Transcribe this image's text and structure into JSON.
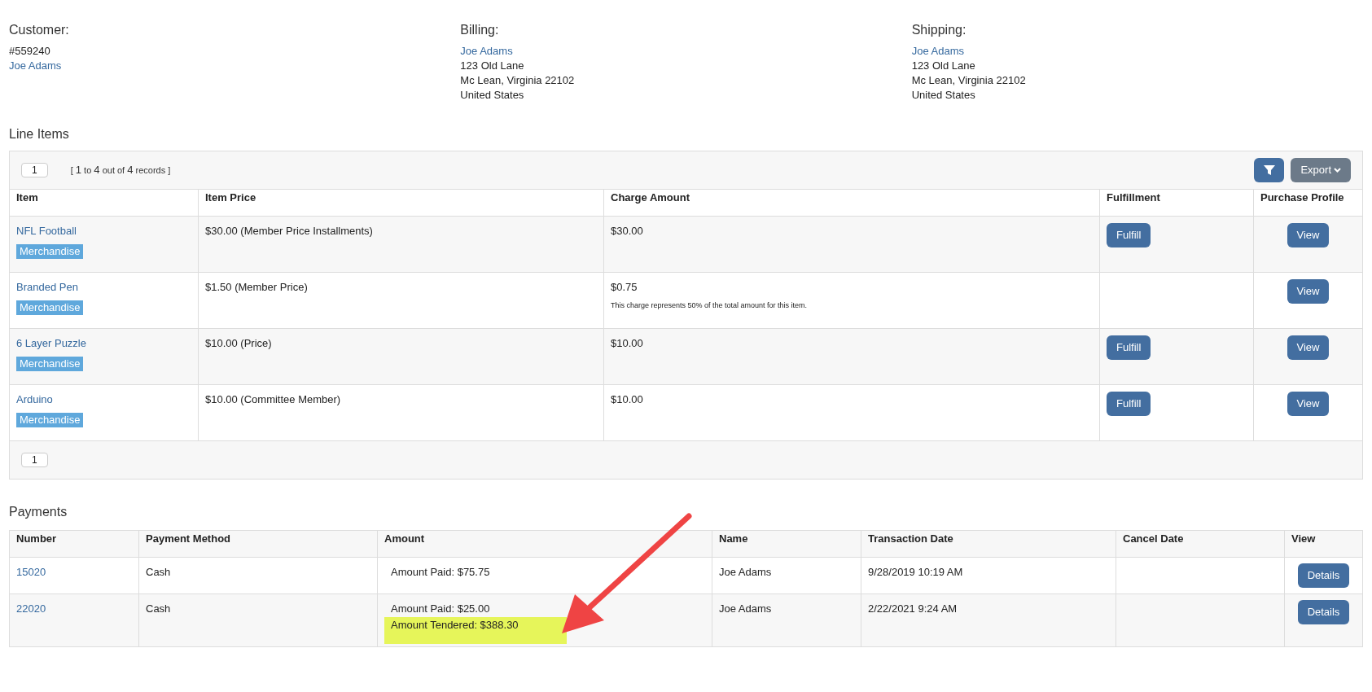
{
  "customer": {
    "heading": "Customer:",
    "number": "#559240",
    "name": "Joe Adams"
  },
  "billing": {
    "heading": "Billing:",
    "name": "Joe Adams",
    "lines": [
      "123 Old Lane",
      "Mc Lean, Virginia 22102",
      "United States"
    ]
  },
  "shipping": {
    "heading": "Shipping:",
    "name": "Joe Adams",
    "lines": [
      "123 Old Lane",
      "Mc Lean, Virginia 22102",
      "United States"
    ]
  },
  "line_items": {
    "title": "Line Items",
    "page": "1",
    "records": {
      "open": "[",
      "from": "1",
      "to_word": "to",
      "to": "4",
      "out_of": "out of",
      "total": "4",
      "unit": "records",
      "close": "]"
    },
    "export": "Export",
    "footer_page": "1",
    "columns": [
      "Item",
      "Item Price",
      "Charge Amount",
      "Fulfillment",
      "Purchase Profile"
    ],
    "rows": [
      {
        "item": "NFL Football",
        "tag": "Merchandise",
        "price": "$30.00 (Member Price Installments)",
        "charge": "$30.00",
        "fulfill": "Fulfill",
        "profile": "View"
      },
      {
        "item": "Branded Pen",
        "tag": "Merchandise",
        "price": "$1.50 (Member Price)",
        "charge": "$0.75",
        "note": "This charge represents 50% of the total amount for this item.",
        "profile": "View"
      },
      {
        "item": "6 Layer Puzzle",
        "tag": "Merchandise",
        "price": "$10.00 (Price)",
        "charge": "$10.00",
        "fulfill": "Fulfill",
        "profile": "View"
      },
      {
        "item": "Arduino",
        "tag": "Merchandise",
        "price": "$10.00 (Committee Member)",
        "charge": "$10.00",
        "fulfill": "Fulfill",
        "profile": "View"
      }
    ]
  },
  "payments": {
    "title": "Payments",
    "columns": [
      "Number",
      "Payment Method",
      "Amount",
      "Name",
      "Transaction Date",
      "Cancel Date",
      "View"
    ],
    "rows": [
      {
        "number": "15020",
        "method": "Cash",
        "amounts": [
          {
            "text": "Amount Paid: $75.75",
            "highlighted": false
          }
        ],
        "name": "Joe Adams",
        "date": "9/28/2019 10:19 AM",
        "action": "Details"
      },
      {
        "number": "22020",
        "method": "Cash",
        "amounts": [
          {
            "text": "Amount Paid: $25.00",
            "highlighted": false
          },
          {
            "text": "Amount Tendered: $388.30",
            "highlighted": true
          }
        ],
        "name": "Joe Adams",
        "date": "2/22/2021 9:24 AM",
        "action": "Details"
      }
    ]
  }
}
